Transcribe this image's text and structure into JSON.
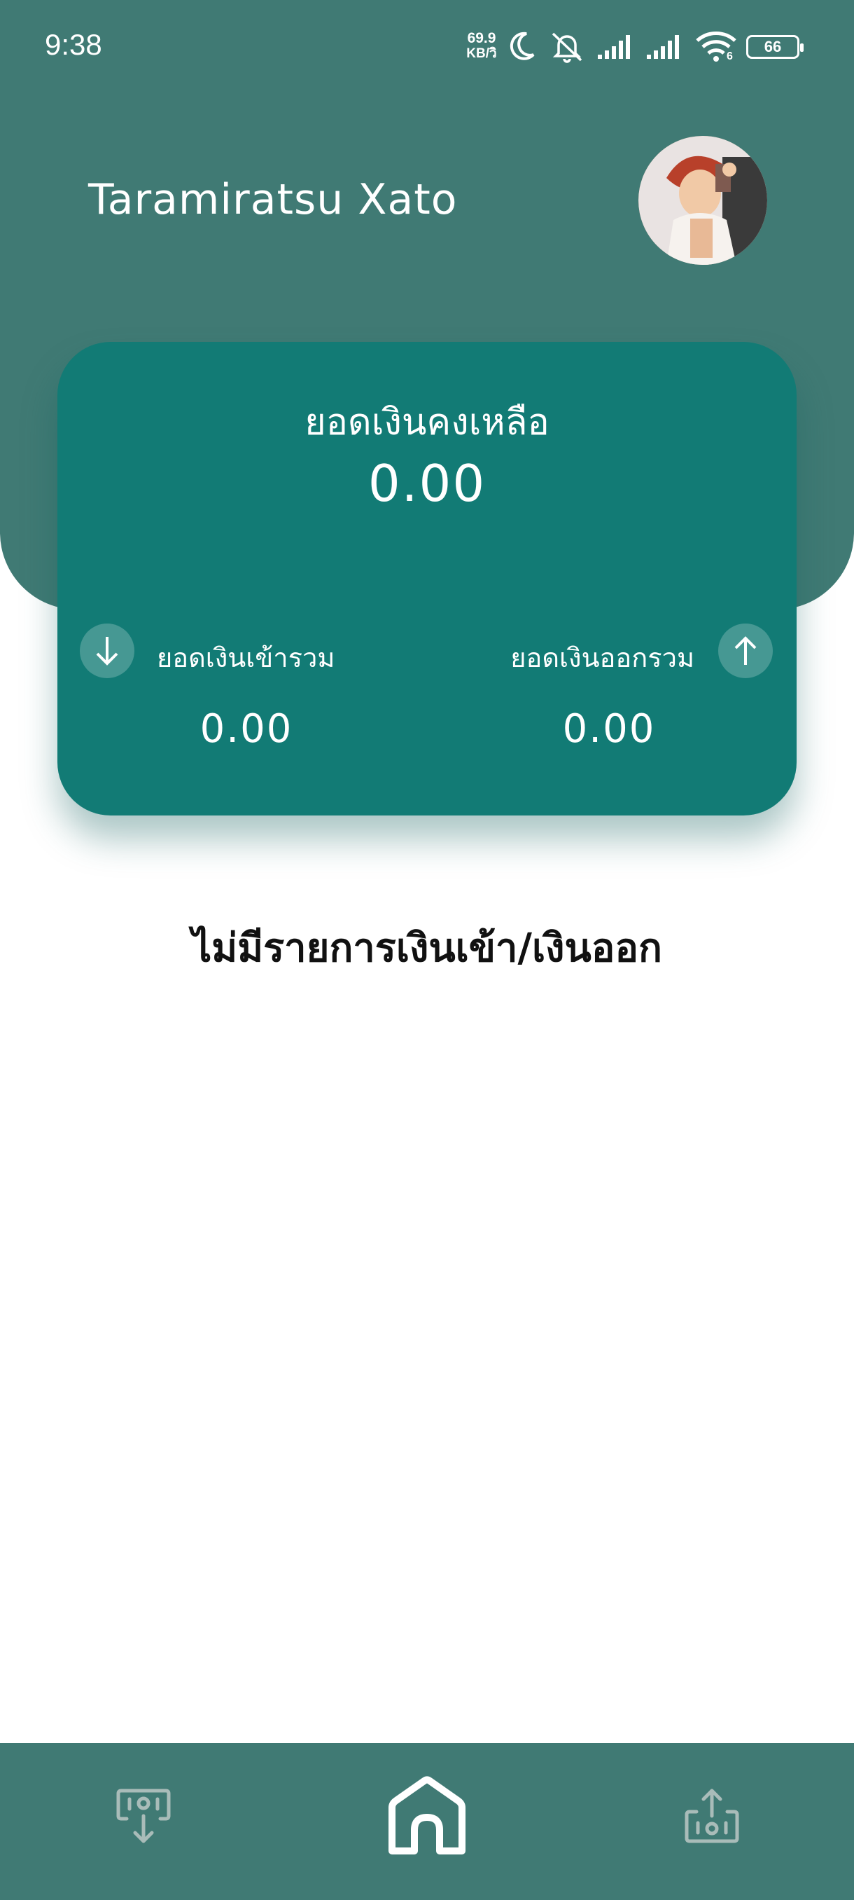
{
  "status_bar": {
    "time": "9:38",
    "network_speed_value": "69.9",
    "network_speed_unit": "KB/วิ",
    "battery_level": "66",
    "wifi_badge": "6"
  },
  "profile": {
    "name": "Taramiratsu Xato"
  },
  "balance_card": {
    "title": "ยอดเงินคงเหลือ",
    "balance": "0.00",
    "income_label": "ยอดเงินเข้ารวม",
    "income_value": "0.00",
    "expense_label": "ยอดเงินออกรวม",
    "expense_value": "0.00"
  },
  "empty_state": {
    "message": "ไม่มีรายการเงินเข้า/เงินออก"
  },
  "bottom_nav": {
    "items": [
      {
        "icon": "deposit-icon",
        "active": false
      },
      {
        "icon": "home-icon",
        "active": true
      },
      {
        "icon": "withdraw-icon",
        "active": false
      }
    ]
  },
  "colors": {
    "header": "#407a74",
    "card": "#127b75",
    "nav": "#407a74",
    "inactive_icon": "#a9bcb9"
  }
}
